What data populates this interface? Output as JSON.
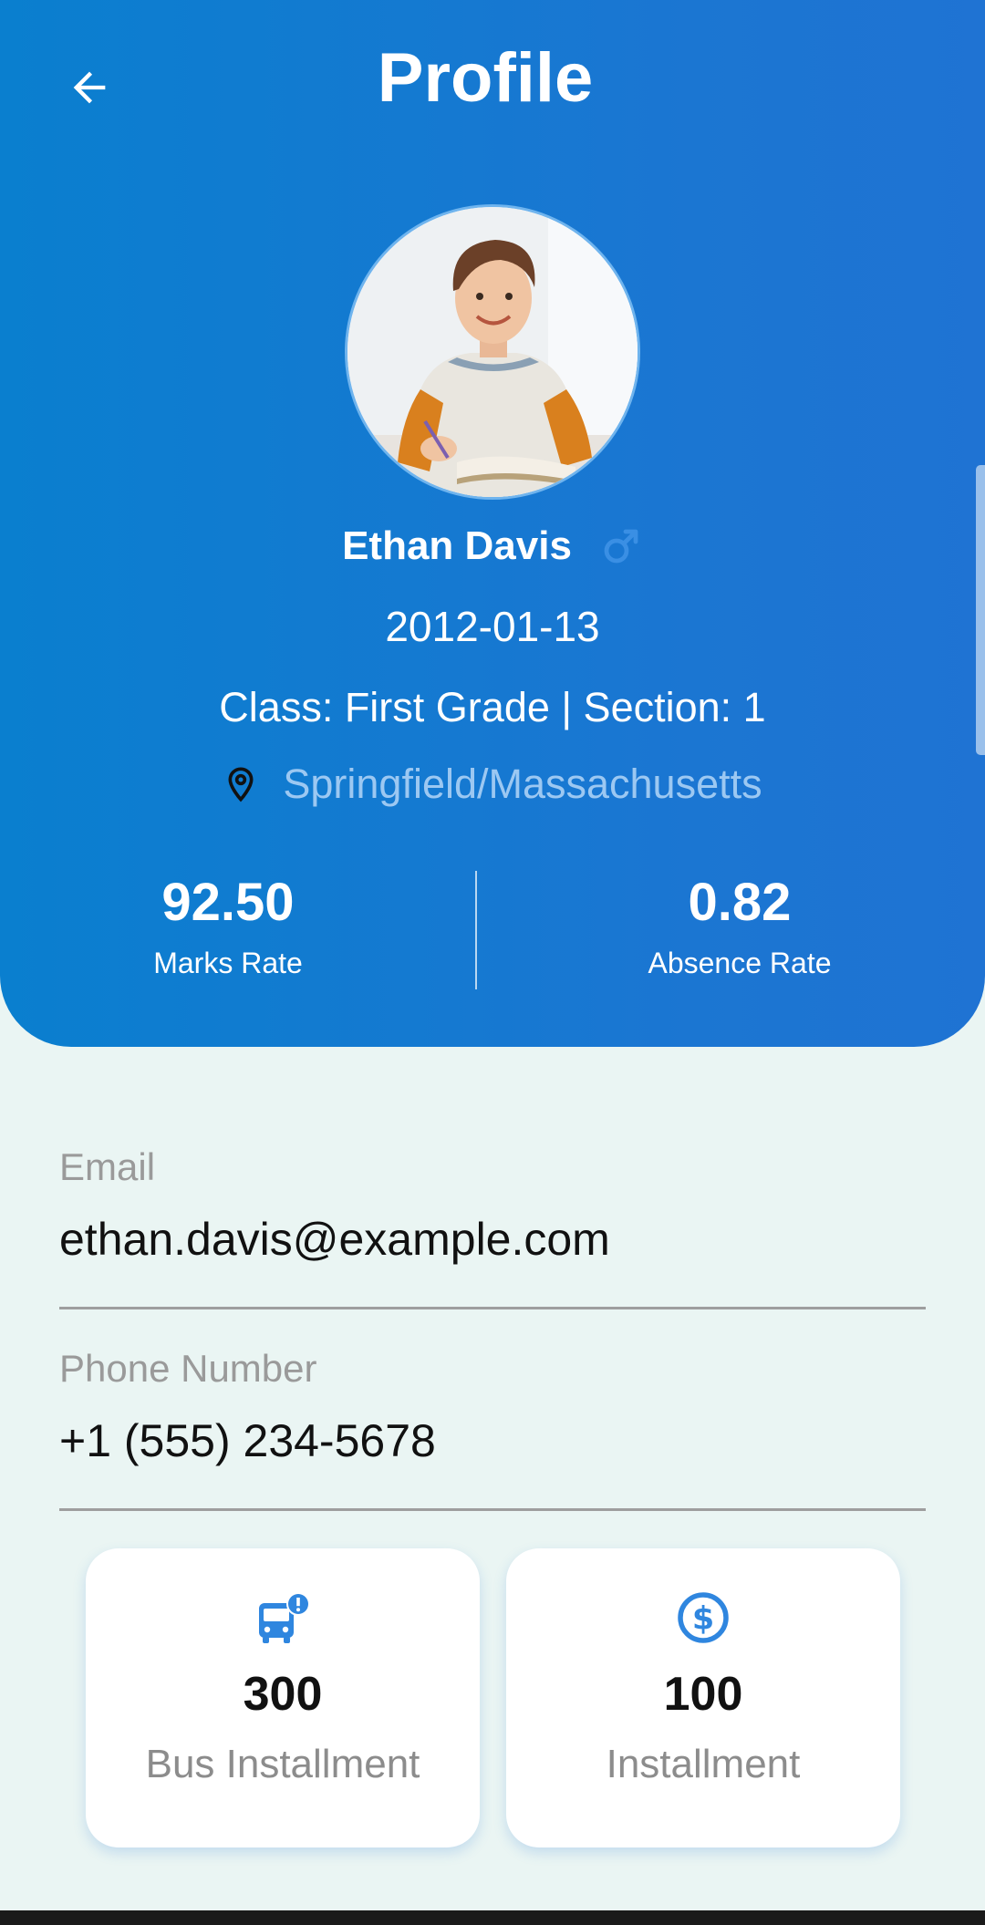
{
  "header": {
    "title": "Profile",
    "back_icon": "arrow-left-icon"
  },
  "profile": {
    "name": "Ethan Davis",
    "gender_icon": "male-icon",
    "dob": "2012-01-13",
    "class_line": "Class: First Grade |  Section: 1",
    "location": "Springfield/Massachusetts",
    "location_icon": "location-pin-icon"
  },
  "stats": {
    "marks_value": "92.50",
    "marks_label": "Marks Rate",
    "absence_value": "0.82",
    "absence_label": "Absence Rate"
  },
  "contact": {
    "email_label": "Email",
    "email_value": "ethan.davis@example.com",
    "phone_label": "Phone Number",
    "phone_value": "+1 (555) 234-5678"
  },
  "cards": [
    {
      "value": "300",
      "label": "Bus Installment",
      "icon": "bus-alert-icon"
    },
    {
      "value": "100",
      "label": "Installment",
      "icon": "dollar-circle-icon"
    }
  ],
  "colors": {
    "header_gradient_start": "#0a7fcf",
    "header_gradient_end": "#1f73d3",
    "accent_icon": "#2f86df",
    "page_background": "#eaf5f3"
  }
}
